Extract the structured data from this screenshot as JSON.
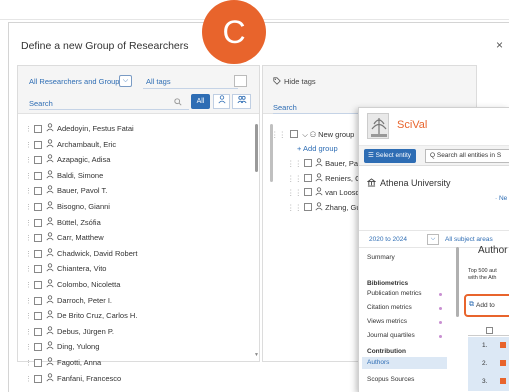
{
  "dialog": {
    "title": "Define a new Group of Researchers",
    "close_glyph": "×",
    "badge_letter": "C"
  },
  "left_panel": {
    "filter_label": "All Researchers and Groups",
    "filter_chevron": "⌵",
    "tags_label": "All tags",
    "search_label": "Search",
    "search_icon": "search-icon",
    "all_button": "All",
    "researchers": [
      "Adedoyin, Festus Fatai",
      "Archambault, Eric",
      "Azapagic, Adisa",
      "Baldi, Simone",
      "Bauer, Pavol T.",
      "Bisogno, Gianni",
      "Büttel, Zsófia",
      "Carr, Matthew",
      "Chadwick, David Robert",
      "Chiantera, Vito",
      "Colombo, Nicoletta",
      "Darroch, Peter I.",
      "De Brito Cruz, Carlos H.",
      "Debus, Jürgen P.",
      "Ding, Yulong",
      "Fagotti, Anna",
      "Fanfani, Francesco"
    ]
  },
  "right_panel": {
    "hide_tags_label": "Hide tags",
    "search_label": "Search",
    "new_group_label": "New group",
    "add_group_label": "+ Add group",
    "group_members": [
      "Bauer, Pavol T.",
      "Reniers, Genser",
      "van Loosdrecht,",
      "Zhang, Guoqi"
    ]
  },
  "scival": {
    "logo_text": "SciVal",
    "select_entity_label": "☰ Select entity",
    "search_placeholder": "Q  Search all entities in S",
    "institution": "Athena University",
    "ne_text": "· Ne",
    "year_range": "2020 to 2024",
    "year_chevron": "⌵",
    "subject_filter": "All subject areas",
    "sidebar": {
      "summary": "Summary",
      "bibliometrics": "Bibliometrics",
      "publication_metrics": "Publication metrics",
      "citation_metrics": "Citation metrics",
      "views_metrics": "Views metrics",
      "journal_quartiles": "Journal quartiles",
      "contribution": "Contribution",
      "authors": "Authors",
      "scopus_sources": "Scopus Sources"
    },
    "main_heading": "Author",
    "top500_line1": "Top 500 aut",
    "top500_line2": "with the Ath",
    "add_to_label": "Add to",
    "rows": [
      "1.",
      "2.",
      "3."
    ]
  }
}
